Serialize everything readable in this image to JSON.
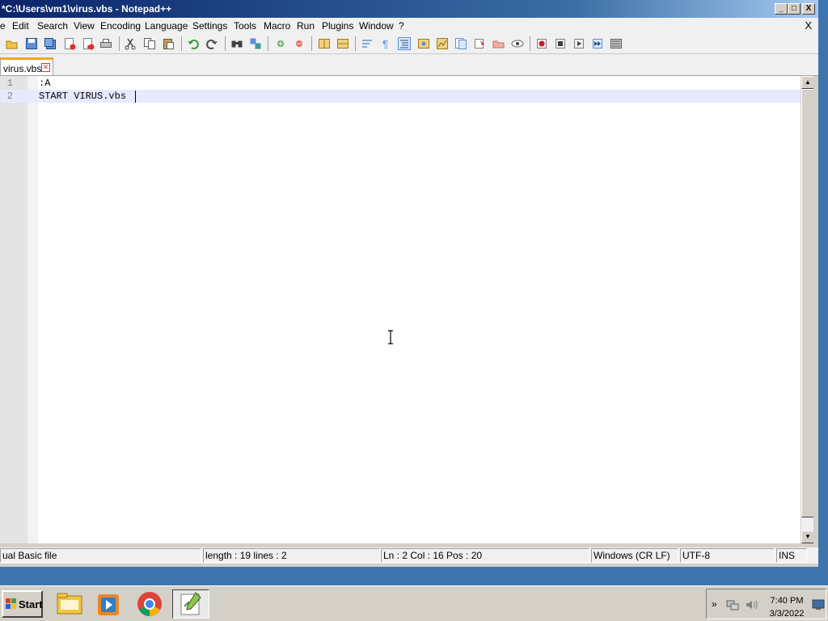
{
  "window": {
    "title": "*C:\\Users\\vm1\\virus.vbs - Notepad++",
    "minimize_glyph": "_",
    "maximize_glyph": "□",
    "close_glyph": "X"
  },
  "menu": {
    "items": [
      "e",
      "Edit",
      "Search",
      "View",
      "Encoding",
      "Language",
      "Settings",
      "Tools",
      "Macro",
      "Run",
      "Plugins",
      "Window",
      "?"
    ],
    "close_doc": "X"
  },
  "toolbar": {
    "icons": [
      "open-icon",
      "save-icon",
      "save-all-icon",
      "close-icon",
      "close-all-icon",
      "print-icon",
      "cut-icon",
      "copy-icon",
      "paste-icon",
      "undo-icon",
      "redo-icon",
      "find-icon",
      "replace-icon",
      "zoom-in-icon",
      "zoom-out-icon",
      "sync-v-icon",
      "sync-h-icon",
      "word-wrap-icon",
      "show-all-chars-icon",
      "indent-guide-icon",
      "udl-icon",
      "doc-map-icon",
      "function-list-icon",
      "folder-workspace-icon",
      "monitor-icon",
      "record-macro-icon",
      "stop-macro-icon",
      "play-macro-icon",
      "run-macro-multiple-icon",
      "save-macro-icon"
    ]
  },
  "tab": {
    "label": "virus.vbs",
    "close_glyph": "✕",
    "accent": "#f5a623"
  },
  "editor": {
    "lines": [
      {
        "num": "1",
        "text": ":A"
      },
      {
        "num": "2",
        "text": "START VIRUS.vbs"
      }
    ],
    "current_line": 2,
    "current_line_color": "#e8e8ff"
  },
  "status": {
    "filetype": "ual Basic file",
    "length": "length : 19    lines : 2",
    "position": "Ln : 2    Col : 16    Pos : 20",
    "eol": "Windows (CR LF)",
    "encoding": "UTF-8",
    "mode": "INS"
  },
  "taskbar": {
    "start_label": "Start",
    "apps": [
      "explorer-icon",
      "media-player-icon",
      "chrome-icon",
      "notepadpp-icon"
    ],
    "tray_chevron": "»",
    "time": "7:40 PM",
    "date": "3/3/2022"
  },
  "colors": {
    "desktop": "#3f74ad",
    "title_start": "#0a246a"
  }
}
